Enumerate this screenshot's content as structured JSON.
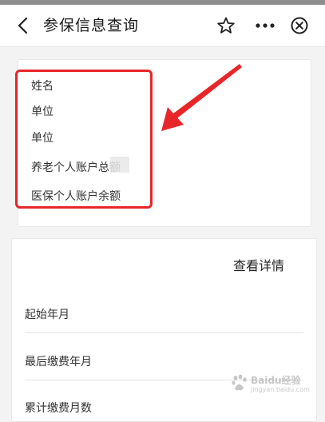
{
  "header": {
    "title": "参保信息查询",
    "icons": [
      "back-icon",
      "star-icon",
      "more-icon",
      "close-icon"
    ]
  },
  "profile_card": {
    "fields": [
      "姓名",
      "单位",
      "单位",
      "养老个人账户总额",
      "医保个人账户余额"
    ]
  },
  "detail_card": {
    "detail_link": "查看详情",
    "rows": [
      "起始年月",
      "最后缴费年月",
      "累计缴费月数"
    ]
  },
  "watermark": {
    "brand": "Baidu经验",
    "sub": "jingyan.baidu.com"
  },
  "colors": {
    "annotation_red": "#e8262a",
    "background": "#f3f3f3",
    "card": "#ffffff"
  }
}
